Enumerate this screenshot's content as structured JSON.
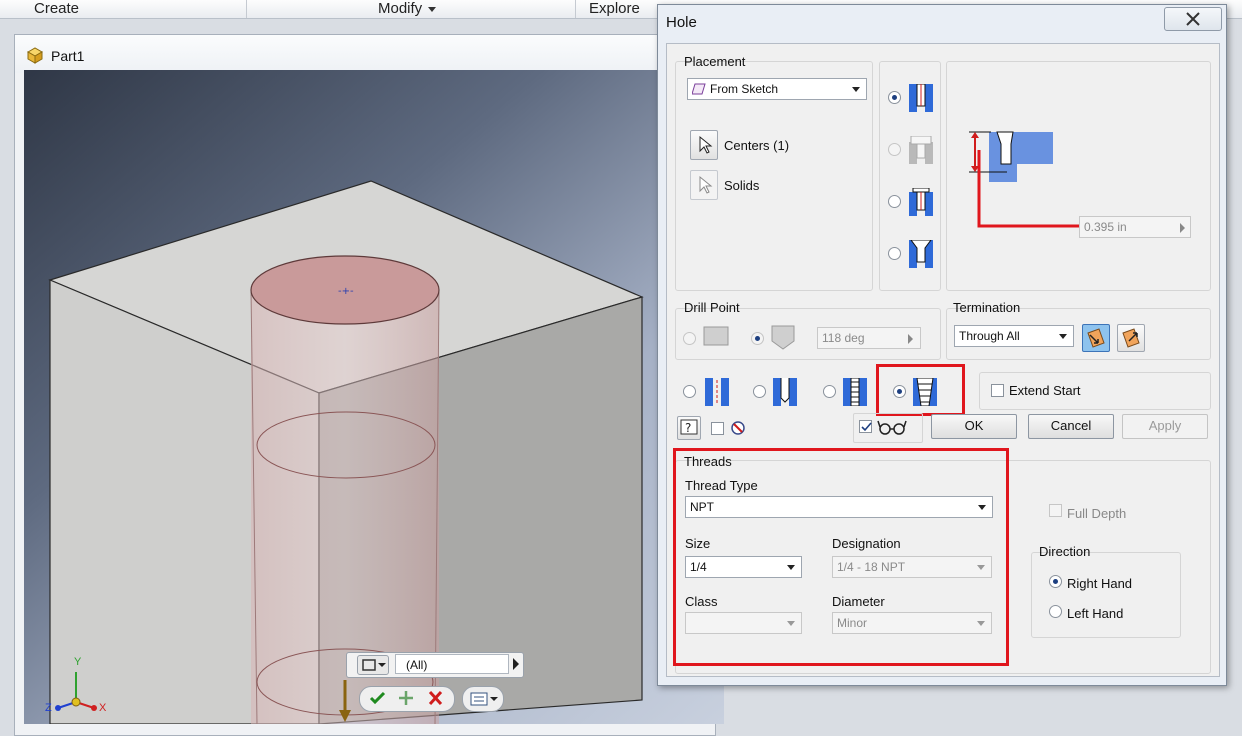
{
  "ribbon": {
    "tabs": [
      {
        "label": "Create"
      },
      {
        "label": "Modify"
      },
      {
        "label": "Explore"
      }
    ]
  },
  "document": {
    "title": "Part1"
  },
  "mini_toolbar": {
    "filter_value": "(All)"
  },
  "triad": {
    "y": "Y",
    "x": "X",
    "z": "Z"
  },
  "dialog": {
    "title": "Hole",
    "placement": {
      "group_label": "Placement",
      "type_value": "From Sketch",
      "centers_label": "Centers (1)",
      "solids_label": "Solids"
    },
    "hole_types": {
      "selected_index": 0
    },
    "preview": {
      "dimension_value": "0.395 in"
    },
    "drill_point": {
      "group_label": "Drill Point",
      "angle_value": "118 deg"
    },
    "termination": {
      "group_label": "Termination",
      "value": "Through All"
    },
    "extend_start_label": "Extend Start",
    "buttons": {
      "ok": "OK",
      "cancel": "Cancel",
      "apply": "Apply"
    },
    "threads": {
      "group_label": "Threads",
      "thread_type_label": "Thread Type",
      "thread_type_value": "NPT",
      "size_label": "Size",
      "size_value": "1/4",
      "designation_label": "Designation",
      "designation_value": "1/4 - 18 NPT",
      "class_label": "Class",
      "class_value": "",
      "diameter_label": "Diameter",
      "diameter_value": "Minor",
      "full_depth_label": "Full Depth",
      "direction_label": "Direction",
      "right_hand_label": "Right Hand",
      "left_hand_label": "Left Hand",
      "selected_direction": "Right Hand"
    }
  },
  "colors": {
    "highlight_red": "#e0161d",
    "hole_blue": "#2f6ad8",
    "hole_face": "#c99a9a"
  }
}
